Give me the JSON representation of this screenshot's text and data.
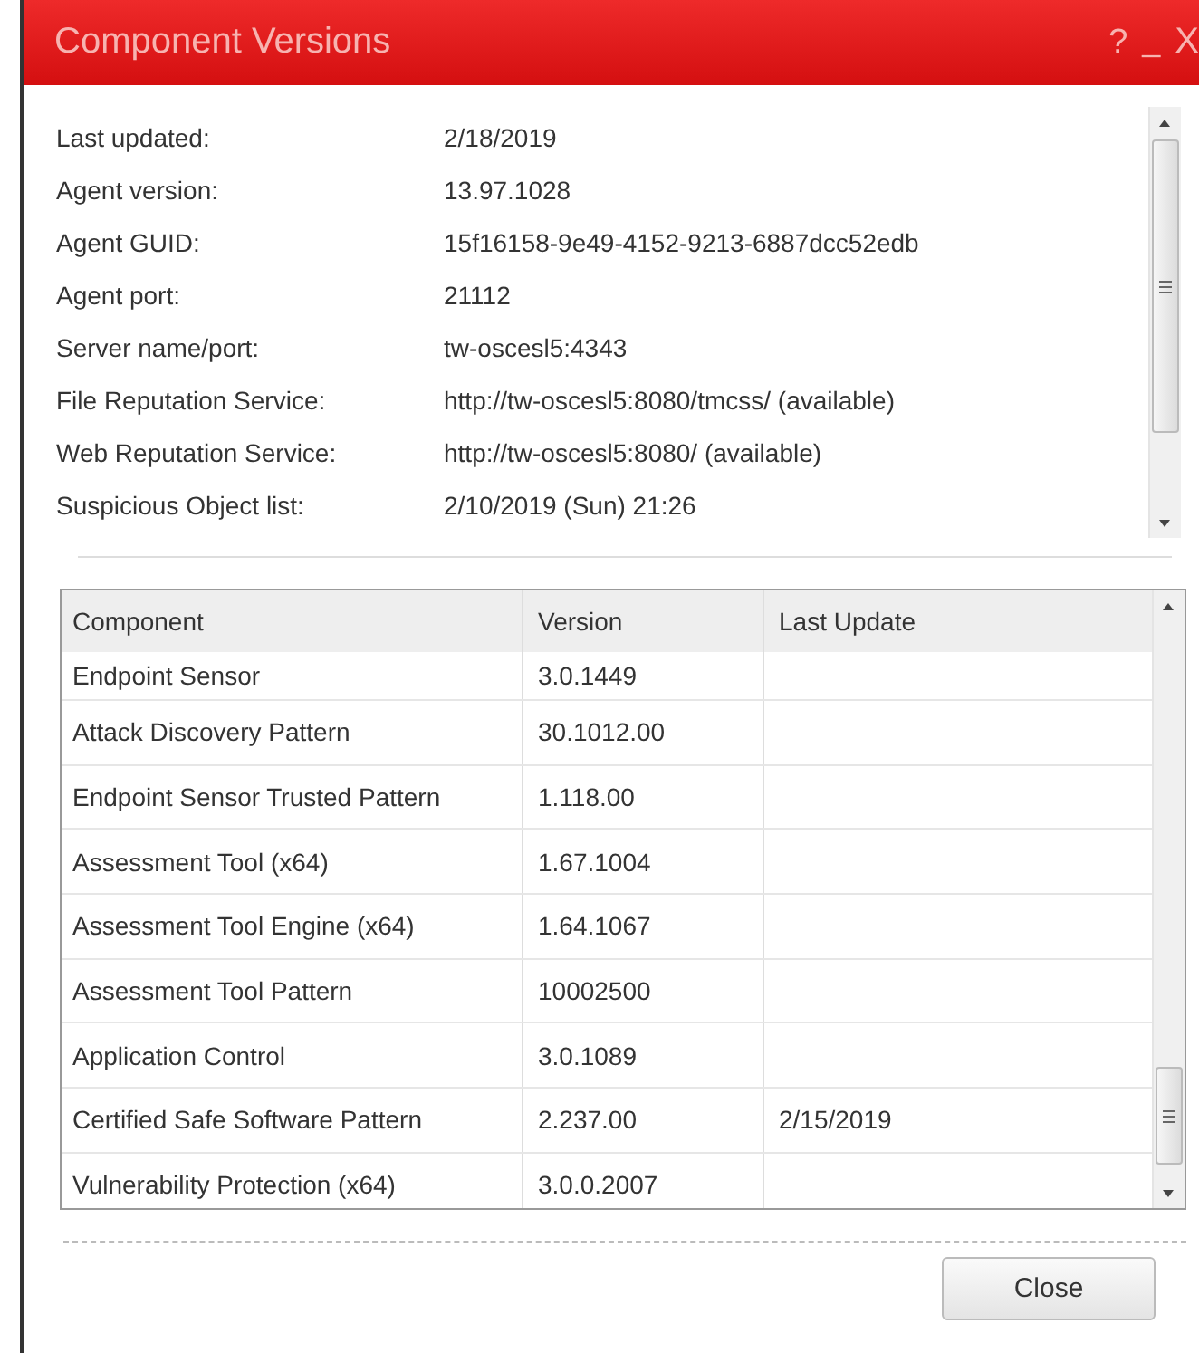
{
  "window": {
    "title": "Component Versions",
    "controls": [
      {
        "kind": "help",
        "label": "?"
      },
      {
        "kind": "minimize",
        "label": "_"
      },
      {
        "kind": "close",
        "label": "X"
      }
    ]
  },
  "info": [
    {
      "label": "Last updated:",
      "value": "2/18/2019"
    },
    {
      "label": "Agent version:",
      "value": "13.97.1028"
    },
    {
      "label": "Agent GUID:",
      "value": "15f16158-9e49-4152-9213-6887dcc52edb"
    },
    {
      "label": "Agent port:",
      "value": "21112"
    },
    {
      "label": "Server name/port:",
      "value": "tw-oscesl5:4343"
    },
    {
      "label": "File Reputation Service:",
      "value": "http://tw-oscesl5:8080/tmcss/ (available)"
    },
    {
      "label": "Web Reputation Service:",
      "value": "http://tw-oscesl5:8080/ (available)"
    },
    {
      "label": "Suspicious Object list:",
      "value": "2/10/2019 (Sun) 21:26"
    }
  ],
  "table": {
    "columns": [
      "Component",
      "Version",
      "Last Update"
    ],
    "rows": [
      [
        "Endpoint Sensor",
        "3.0.1449",
        ""
      ],
      [
        "Attack Discovery Pattern",
        "30.1012.00",
        ""
      ],
      [
        "Endpoint Sensor Trusted Pattern",
        "1.118.00",
        ""
      ],
      [
        "Assessment Tool (x64)",
        "1.67.1004",
        ""
      ],
      [
        "Assessment Tool Engine (x64)",
        "1.64.1067",
        ""
      ],
      [
        "Assessment Tool Pattern",
        "10002500",
        ""
      ],
      [
        "Application Control",
        "3.0.1089",
        ""
      ],
      [
        "Certified Safe Software Pattern",
        "2.237.00",
        "2/15/2019"
      ],
      [
        "Vulnerability Protection (x64)",
        "3.0.0.2007",
        ""
      ]
    ]
  },
  "buttons": [
    "Close"
  ]
}
